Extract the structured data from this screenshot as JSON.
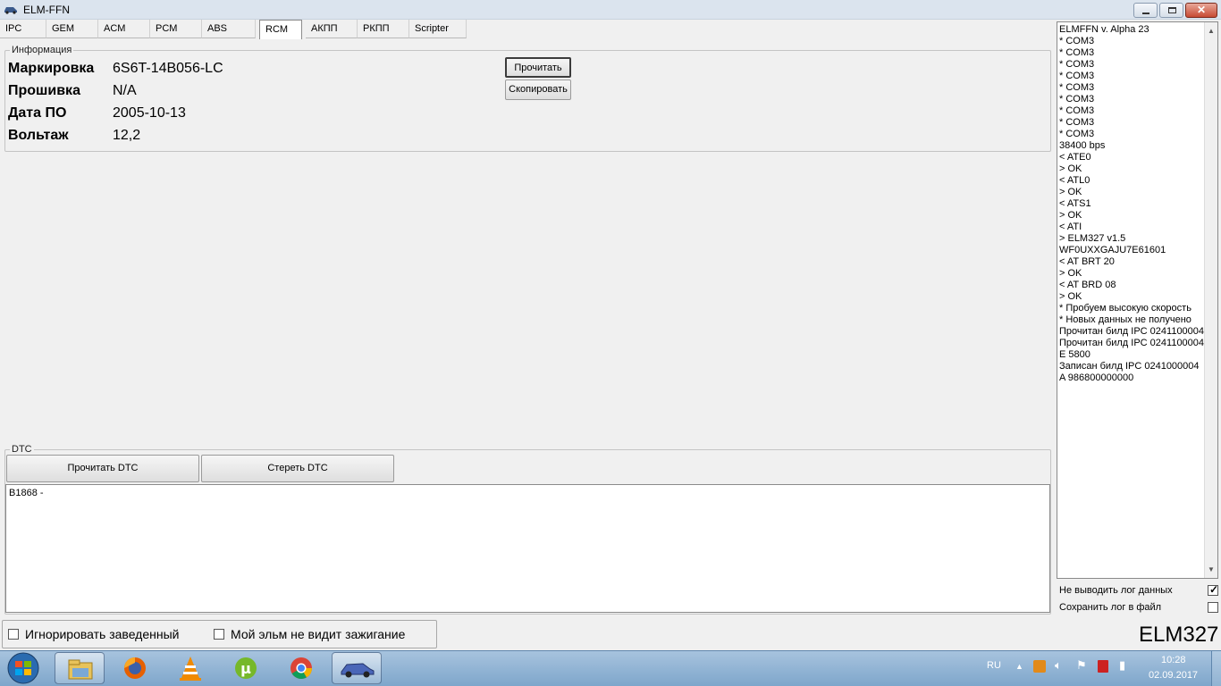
{
  "window": {
    "title": "ELM-FFN"
  },
  "tabs": [
    "IPC",
    "GEM",
    "ACM",
    "PCM",
    "ABS",
    "RCM",
    "АКПП",
    "РКПП",
    "Scripter"
  ],
  "active_tab": "RCM",
  "info": {
    "legend": "Информация",
    "rows": [
      {
        "label": "Маркировка",
        "value": "6S6T-14B056-LC"
      },
      {
        "label": "Прошивка",
        "value": "N/A"
      },
      {
        "label": "Дата ПО",
        "value": "2005-10-13"
      },
      {
        "label": "Вольтаж",
        "value": "12,2"
      }
    ],
    "read_button": "Прочитать",
    "copy_button": "Скопировать"
  },
  "dtc": {
    "legend": "DTC",
    "read_button": "Прочитать DTC",
    "clear_button": "Стереть DTC",
    "text": "B1868 -"
  },
  "log": {
    "lines": [
      "ELMFFN v. Alpha 23",
      "* COM3",
      "* COM3",
      "* COM3",
      "* COM3",
      "* COM3",
      "* COM3",
      "* COM3",
      "* COM3",
      "* COM3",
      "38400 bps",
      "< ATE0",
      "> OK",
      "< ATL0",
      "> OK",
      "< ATS1",
      "> OK",
      "< ATI",
      "> ELM327 v1.5",
      "WF0UXXGAJU7E61601",
      "< AT BRT 20",
      "> OK",
      "< AT BRD 08",
      "> OK",
      "* Пробуем высокую скорость",
      "* Новых данных не получено",
      "Прочитан билд IPC 0241100004",
      "Прочитан билд IPC 0241100004",
      "E 5800",
      "Записан билд IPC 0241000004",
      "A 986800000000"
    ],
    "no_log_label": "Не выводить лог данных",
    "no_log_checked": true,
    "save_log_label": "Сохранить лог в файл",
    "save_log_checked": false
  },
  "bottom": {
    "ignore_running_label": "Игнорировать заведенный",
    "no_ignition_label": "Мой эльм не видит зажигание",
    "adapter": "ELM327"
  },
  "taskbar": {
    "lang": "RU",
    "time": "10:28",
    "date": "02.09.2017",
    "apps": [
      "start-icon",
      "explorer-icon",
      "firefox-icon",
      "vlc-icon",
      "utorrent-icon",
      "chrome-icon",
      "elm-ffn-car-icon"
    ]
  },
  "colors": {
    "taskbar": "#8fb2d4",
    "window_bg": "#f0f0f0",
    "close_button": "#c74a33"
  }
}
